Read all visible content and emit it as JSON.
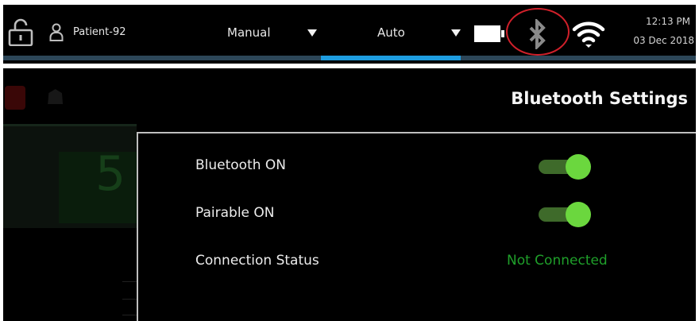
{
  "header": {
    "lock_icon": "lock-icon",
    "user_icon": "user-icon",
    "patient": "Patient-92",
    "modes": [
      {
        "label": "Manual",
        "dropdown_icon": "chevron-down-icon"
      },
      {
        "label": "Auto",
        "dropdown_icon": "chevron-down-icon"
      }
    ],
    "battery_icon": "battery-icon",
    "bluetooth_icon": "bluetooth-icon",
    "bluetooth_highlight_color": "#d0202a",
    "wifi_icon": "wifi-icon",
    "time": "12:13 PM",
    "date": "03 Dec 2018",
    "active_tab_color": "#1e9de0"
  },
  "page": {
    "title": "Bluetooth Settings"
  },
  "background": {
    "value": "5"
  },
  "settings": {
    "rows": [
      {
        "label": "Bluetooth ON",
        "control": "toggle",
        "on": true
      },
      {
        "label": "Pairable ON",
        "control": "toggle",
        "on": true
      },
      {
        "label": "Connection Status",
        "control": "status",
        "status": "Not Connected"
      }
    ],
    "toggle_on_color": "#6bd73e",
    "status_color": "#1f9f2a"
  }
}
